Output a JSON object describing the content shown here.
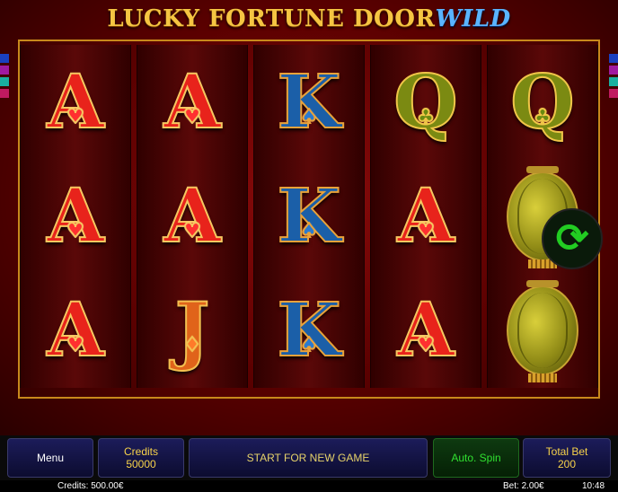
{
  "game": {
    "title_main": "LUCKY FORTUNE DOOR",
    "title_wild": "WILD"
  },
  "reels": [
    [
      {
        "type": "A",
        "suit": "♥"
      },
      {
        "type": "A",
        "suit": "♥"
      },
      {
        "type": "A",
        "suit": "♥"
      }
    ],
    [
      {
        "type": "A",
        "suit": "♥"
      },
      {
        "type": "A",
        "suit": "♥"
      },
      {
        "type": "J",
        "suit": "♦"
      }
    ],
    [
      {
        "type": "K",
        "suit": "♠"
      },
      {
        "type": "K",
        "suit": "♠"
      },
      {
        "type": "K",
        "suit": "♠"
      }
    ],
    [
      {
        "type": "Q",
        "suit": "♣"
      },
      {
        "type": "A",
        "suit": "♥"
      },
      {
        "type": "A",
        "suit": "♥"
      }
    ],
    [
      {
        "type": "Q",
        "suit": "♣"
      },
      {
        "type": "lantern",
        "suit": ""
      },
      {
        "type": "lantern",
        "suit": ""
      }
    ]
  ],
  "controls": {
    "menu": "Menu",
    "credits_label": "Credits",
    "credits_value": "50000",
    "start": "START FOR NEW GAME",
    "autospin": "Auto. Spin",
    "total_bet_label": "Total Bet",
    "total_bet_value": "200",
    "spin_icon": "refresh-arrows-icon"
  },
  "status": {
    "credits": "Credits: 500.00€",
    "bet": "Bet: 2.00€",
    "time": "10:48"
  },
  "colors": {
    "accent_gold": "#c8891c",
    "background_red": "#5a0000",
    "spin_green": "#22cc22",
    "button_blue": "#1c1c5a"
  }
}
